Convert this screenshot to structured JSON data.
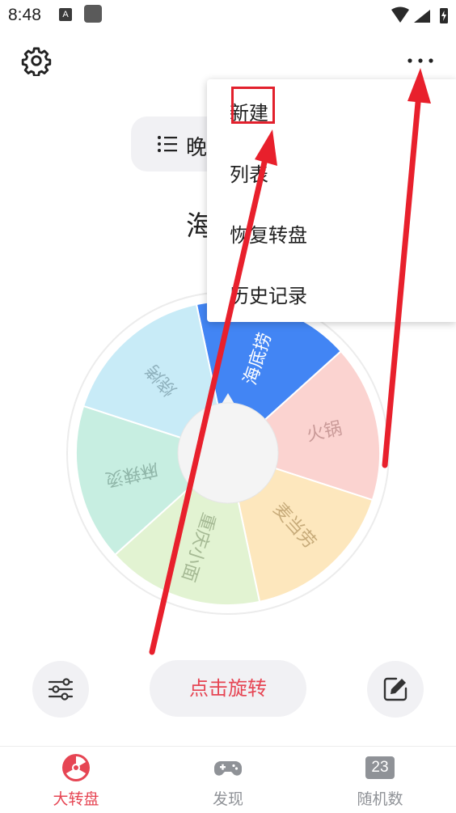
{
  "status_bar": {
    "time": "8:48",
    "a_icon": "A"
  },
  "top_bar": {
    "settings_icon": "gear-icon",
    "more_icon": "more-dots-icon"
  },
  "title": {
    "text": "晚",
    "icon": "list-icon"
  },
  "result": {
    "text": "海"
  },
  "wheel": {
    "segments": [
      {
        "label": "海底捞",
        "color": "#4285f4",
        "text_color": "#ffffff"
      },
      {
        "label": "火锅",
        "color": "#fbd3d0",
        "text_color": "#c99a98"
      },
      {
        "label": "麦当劳",
        "color": "#fde7bd",
        "text_color": "#c7ab7a"
      },
      {
        "label": "重庆小面",
        "color": "#e2f3d2",
        "text_color": "#a5b994"
      },
      {
        "label": "麻辣烫",
        "color": "#c7eee1",
        "text_color": "#8fb5a8"
      },
      {
        "label": "烧烤",
        "color": "#c8ebf7",
        "text_color": "#8fb1bd"
      }
    ]
  },
  "menu": {
    "items": [
      {
        "label": "新建"
      },
      {
        "label": "列表"
      },
      {
        "label": "恢复转盘"
      },
      {
        "label": "历史记录"
      }
    ],
    "highlight_color": "#e2202c"
  },
  "controls": {
    "spin_label": "点击旋转",
    "left_icon": "sliders-icon",
    "right_icon": "edit-icon",
    "accent": "#e64553"
  },
  "nav": {
    "items": [
      {
        "label": "大转盘",
        "icon": "wheel-icon",
        "active": true
      },
      {
        "label": "发现",
        "icon": "gamepad-icon",
        "active": false
      },
      {
        "label": "随机数",
        "icon": "number-icon",
        "badge": "23",
        "active": false
      }
    ],
    "active_color": "#e64553",
    "inactive_color": "#8f9297"
  },
  "annotation_color": "#e8202c"
}
